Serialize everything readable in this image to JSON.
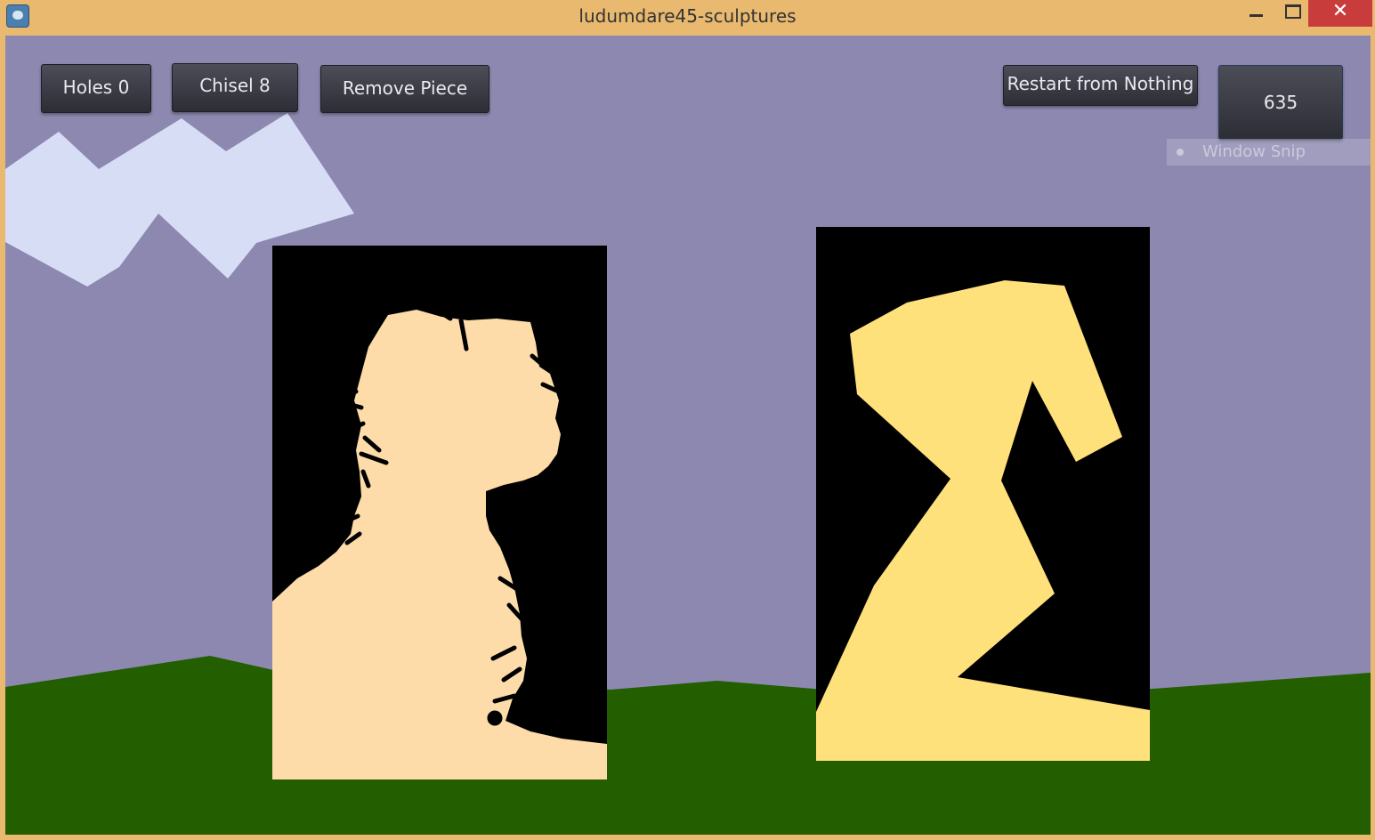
{
  "window": {
    "title": "ludumdare45-sculptures",
    "icon": "godot-icon",
    "controls": [
      "minimize-icon",
      "maximize-icon",
      "close-icon"
    ],
    "close_glyph": "✕"
  },
  "hud": {
    "holes_label": "Holes  0",
    "chisel_label": "Chisel 8",
    "remove_label": "Remove Piece",
    "restart_label": "Restart from Nothing",
    "score": "635"
  },
  "overlay": {
    "snip_label": "Window Snip"
  },
  "colors": {
    "sky": "#8c88b0",
    "ground": "#235e00",
    "cloud": "#d8ddf6",
    "block": "#000000",
    "sculpture_left": "#fddcaa",
    "sculpture_right": "#ffe17c",
    "title_bar": "#e8b96f"
  }
}
